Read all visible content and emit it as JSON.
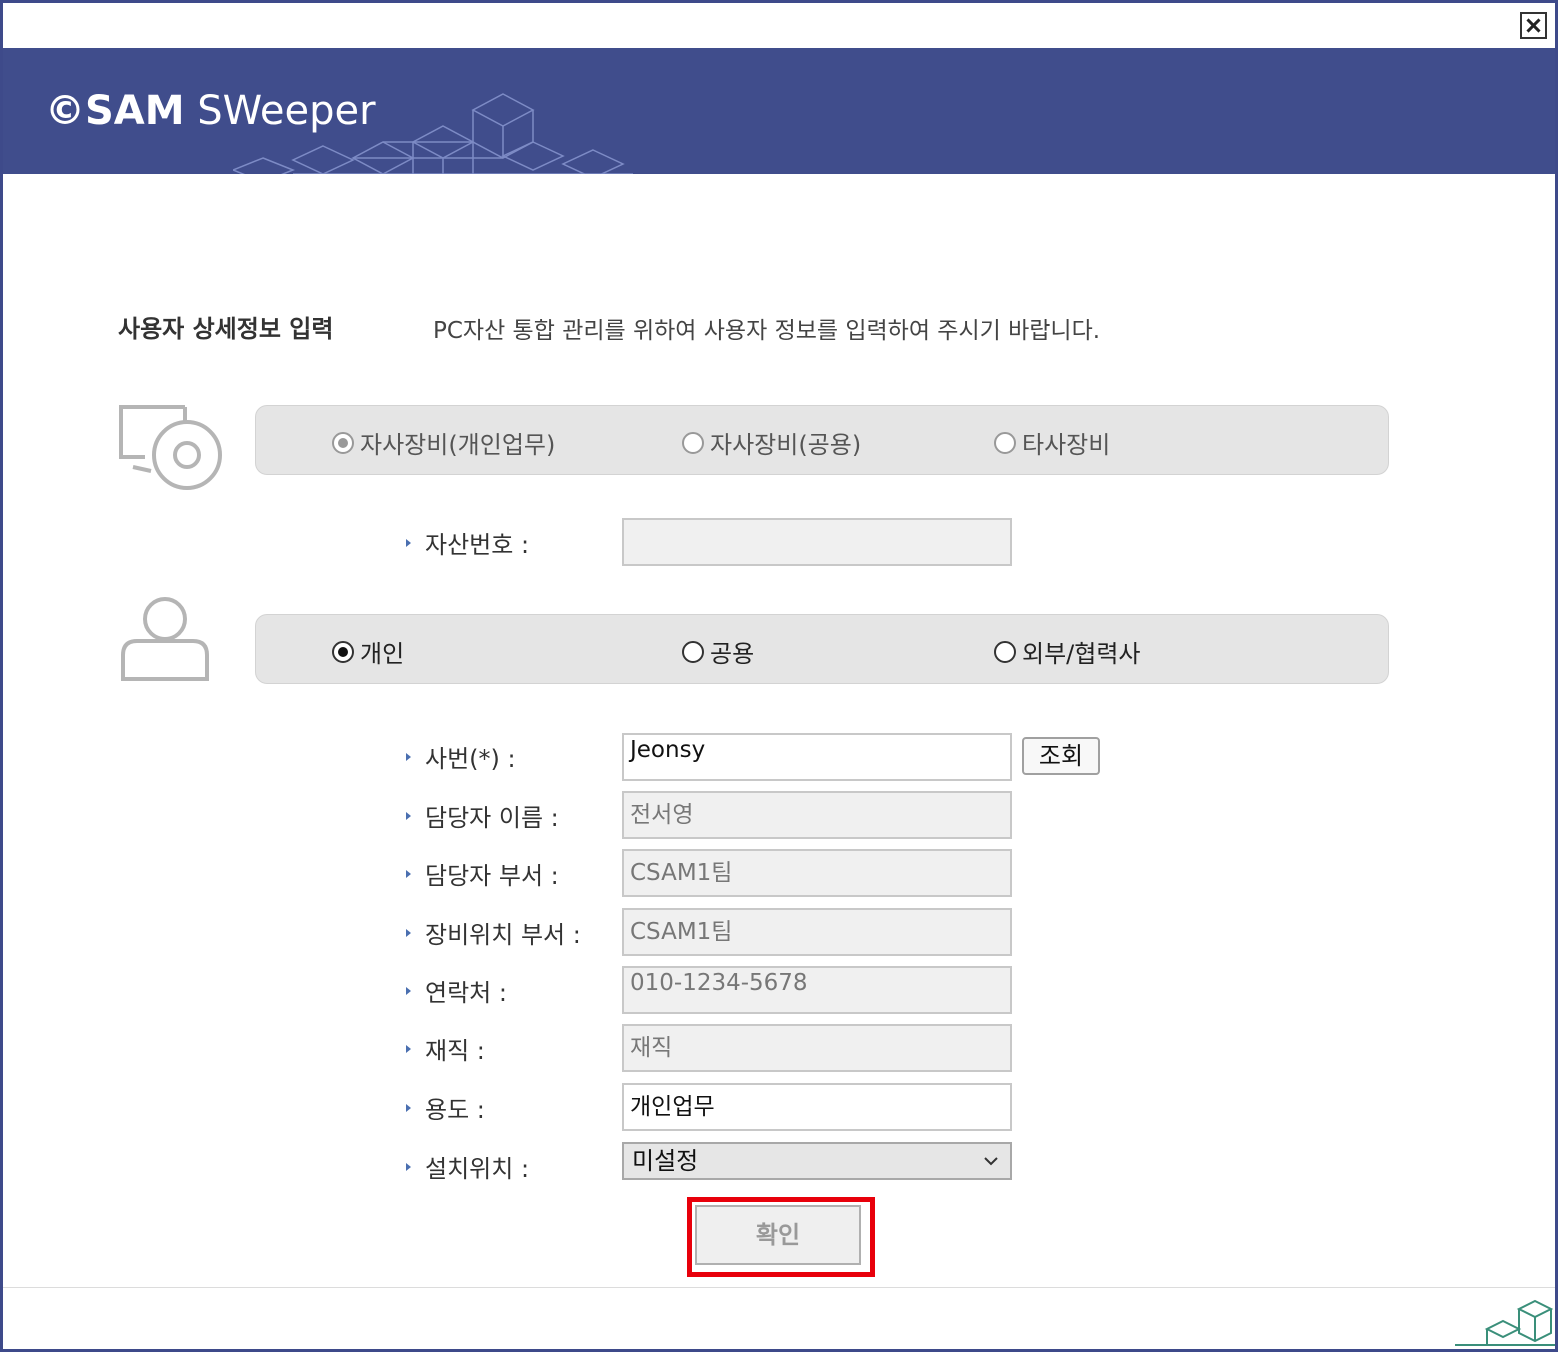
{
  "window": {
    "close_label": "close"
  },
  "banner": {
    "logo_c": "©",
    "logo_sam": "SAM",
    "logo_sweeper": " SWeeper"
  },
  "section": {
    "title": "사용자 상세정보 입력",
    "description": "PC자산 통합 관리를 위하여 사용자 정보를 입력하여 주시기 바랍니다."
  },
  "equipment_type": {
    "options": [
      "자사장비(개인업무)",
      "자사장비(공용)",
      "타사장비"
    ],
    "selected": "자사장비(개인업무)"
  },
  "asset_number": {
    "label": "자산번호 :",
    "value": ""
  },
  "user_type": {
    "options": [
      "개인",
      "공용",
      "외부/협력사"
    ],
    "selected": "개인"
  },
  "fields": {
    "employee_id": {
      "label": "사번(*) :",
      "value": "Jeonsy"
    },
    "manager_name": {
      "label": "담당자 이름 :",
      "value": "전서영"
    },
    "manager_dept": {
      "label": "담당자 부서 :",
      "value": "CSAM1팀"
    },
    "location_dept": {
      "label": "장비위치 부서 :",
      "value": "CSAM1팀"
    },
    "contact": {
      "label": "연락처 :",
      "value": "010-1234-5678"
    },
    "employment": {
      "label": "재직 :",
      "value": "재직"
    },
    "purpose": {
      "label": "용도 :",
      "value": "개인업무"
    },
    "install_location": {
      "label": "설치위치 :",
      "value": "미설정"
    }
  },
  "buttons": {
    "lookup": "조회",
    "confirm": "확인"
  },
  "colors": {
    "banner": "#404d8c",
    "highlight": "#e8000b",
    "bullet": "#4a6fb0"
  }
}
